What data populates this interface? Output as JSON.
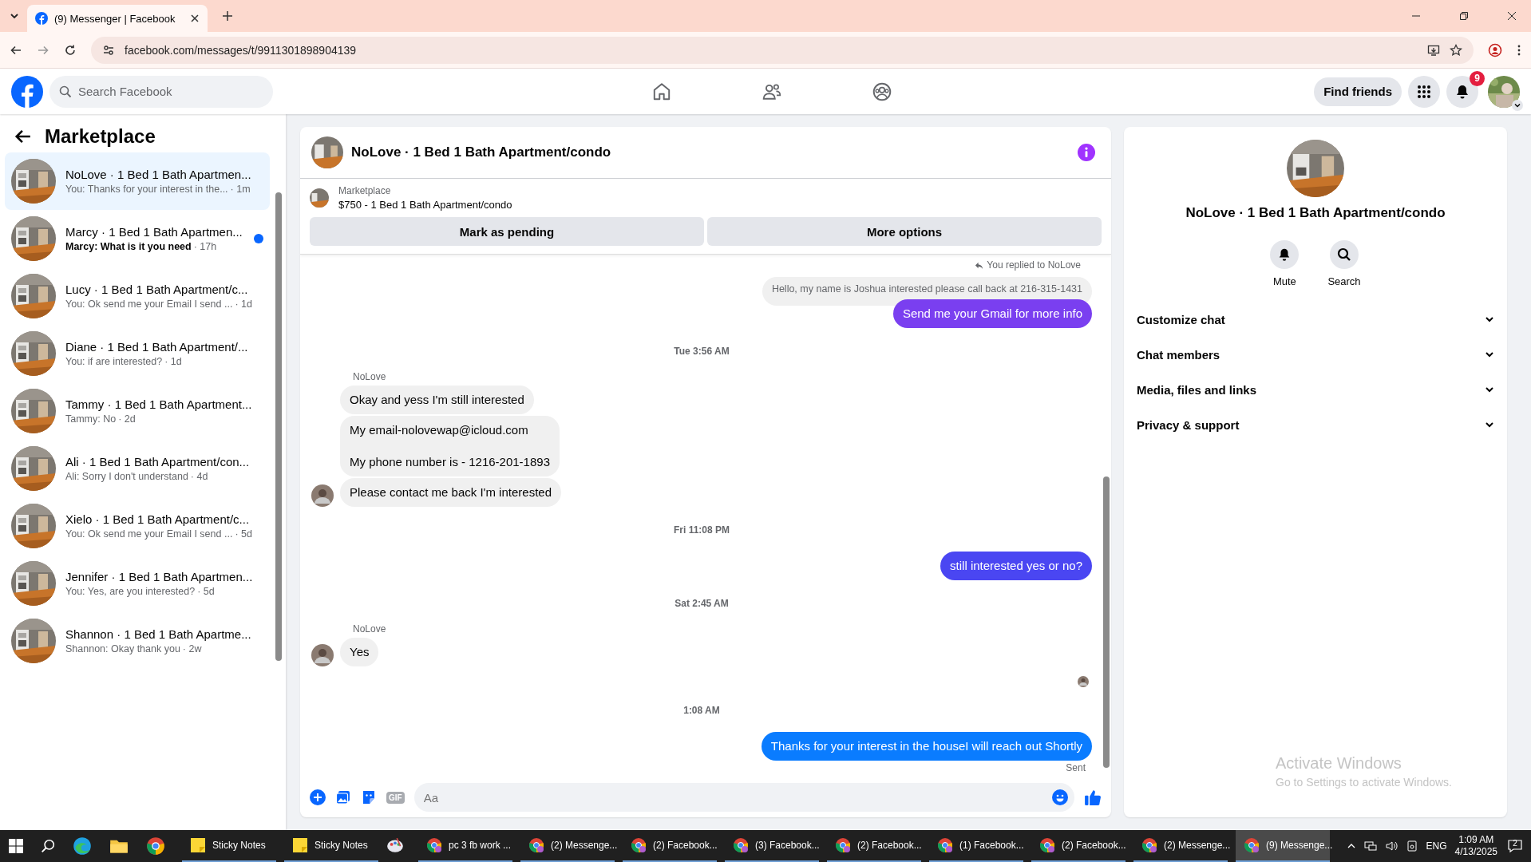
{
  "browser": {
    "tab_title": "(9) Messenger | Facebook",
    "url": "facebook.com/messages/t/9911301898904139"
  },
  "topbar": {
    "search_placeholder": "Search Facebook",
    "find_friends": "Find friends",
    "notification_count": "9"
  },
  "sidebar": {
    "title": "Marketplace",
    "conversations": [
      {
        "name": "NoLove · 1 Bed 1 Bath Apartmen...",
        "preview": "You: Thanks for your interest in the...",
        "time": "· 1m",
        "selected": true,
        "unread": false
      },
      {
        "name": "Marcy · 1 Bed 1 Bath Apartmen...",
        "preview": "Marcy: What is it you need",
        "time": "· 17h",
        "selected": false,
        "unread": true
      },
      {
        "name": "Lucy · 1 Bed 1 Bath Apartment/c...",
        "preview": "You: Ok send me your Email I send ...",
        "time": "· 1d",
        "selected": false,
        "unread": false
      },
      {
        "name": "Diane · 1 Bed 1 Bath Apartment/...",
        "preview": "You: if are interested?",
        "time": "· 1d",
        "selected": false,
        "unread": false
      },
      {
        "name": "Tammy · 1 Bed 1 Bath Apartment...",
        "preview": "Tammy: No",
        "time": "· 2d",
        "selected": false,
        "unread": false
      },
      {
        "name": "Ali · 1 Bed 1 Bath Apartment/con...",
        "preview": "Ali: Sorry I don't understand",
        "time": "· 4d",
        "selected": false,
        "unread": false
      },
      {
        "name": "Xielo · 1 Bed 1 Bath Apartment/c...",
        "preview": "You: Ok send me your Email I send ...",
        "time": "· 5d",
        "selected": false,
        "unread": false
      },
      {
        "name": "Jennifer · 1 Bed 1 Bath Apartmen...",
        "preview": "You: Yes, are you interested?",
        "time": "· 5d",
        "selected": false,
        "unread": false
      },
      {
        "name": "Shannon · 1 Bed 1 Bath Apartme...",
        "preview": "Shannon: Okay thank you",
        "time": "· 2w",
        "selected": false,
        "unread": false
      }
    ]
  },
  "chat": {
    "title": "NoLove · 1 Bed 1 Bath Apartment/condo",
    "listing_label": "Marketplace",
    "listing": "$750 - 1 Bed 1 Bath Apartment/condo",
    "buttons": [
      "Mark as pending",
      "More options"
    ],
    "messages": [
      {
        "kind": "reply_note",
        "text": "You replied to NoLove"
      },
      {
        "kind": "quoted",
        "text": "Hello, my name is Joshua interested please call back at 216-315-1431"
      },
      {
        "kind": "outgoing",
        "lines": [
          "Send me your Gmail for more info"
        ],
        "color": "#7a3ff0"
      },
      {
        "kind": "timestamp",
        "text": "Tue 3:56 AM"
      },
      {
        "kind": "sender",
        "text": "NoLove"
      },
      {
        "kind": "incoming",
        "lines": [
          "Okay and yess I'm still interested"
        ],
        "avatar": false
      },
      {
        "kind": "incoming",
        "lines": [
          "My email-nolovewap@icloud.com",
          "My phone number is - 1216-201-1893"
        ],
        "avatar": false
      },
      {
        "kind": "incoming",
        "lines": [
          "Please contact me back I'm interested"
        ],
        "avatar": true
      },
      {
        "kind": "timestamp",
        "text": "Fri 11:08 PM"
      },
      {
        "kind": "outgoing",
        "lines": [
          "still interested yes or no?"
        ],
        "color": "#4a46f2"
      },
      {
        "kind": "timestamp",
        "text": "Sat 2:45 AM"
      },
      {
        "kind": "sender",
        "text": "NoLove"
      },
      {
        "kind": "incoming",
        "lines": [
          "Yes"
        ],
        "avatar": true
      },
      {
        "kind": "read_receipt"
      },
      {
        "kind": "timestamp",
        "text": "1:08 AM"
      },
      {
        "kind": "outgoing",
        "lines": [
          "Thanks for your interest in the houseI will reach out Shortly"
        ],
        "color": "#0a7cff"
      },
      {
        "kind": "status",
        "text": "Sent"
      }
    ],
    "composer": {
      "placeholder": "Aa",
      "gif": "GIF"
    }
  },
  "details": {
    "title": "NoLove · 1 Bed 1 Bath Apartment/condo",
    "actions": [
      {
        "kind": "mute",
        "label": "Mute"
      },
      {
        "kind": "search",
        "label": "Search"
      }
    ],
    "sections": [
      {
        "label": "Customize chat",
        "expanded": false
      },
      {
        "label": "Chat members",
        "expanded": false
      },
      {
        "label": "Media, files and links",
        "expanded": false
      },
      {
        "label": "Privacy & support",
        "expanded": false
      }
    ]
  },
  "os_notice": {
    "title": "Activate Windows",
    "text": "Go to Settings to activate Windows."
  },
  "taskbar": {
    "apps": [
      {
        "kind": "sticky",
        "label": "Sticky Notes",
        "selected": false
      },
      {
        "kind": "sticky",
        "label": "Sticky Notes",
        "selected": false
      },
      {
        "kind": "paint",
        "selected": false
      },
      {
        "kind": "chrome",
        "label": "pc 3 fb work ...",
        "selected": false
      },
      {
        "kind": "chrome",
        "label": "(2) Messenge...",
        "selected": false
      },
      {
        "kind": "chrome",
        "label": "(2) Facebook...",
        "selected": false
      },
      {
        "kind": "chrome",
        "label": "(3) Facebook...",
        "selected": false
      },
      {
        "kind": "chrome",
        "label": "(2) Facebook...",
        "selected": false
      },
      {
        "kind": "chrome",
        "label": "(1) Facebook...",
        "selected": false
      },
      {
        "kind": "chrome",
        "label": "(2) Facebook...",
        "selected": false
      },
      {
        "kind": "chrome",
        "label": "(2) Messenge...",
        "selected": false
      },
      {
        "kind": "chrome",
        "label": "(9) Messenge...",
        "selected": true
      }
    ],
    "language": "ENG",
    "time": "1:09 AM",
    "date": "4/13/2025",
    "notifications": "2"
  }
}
